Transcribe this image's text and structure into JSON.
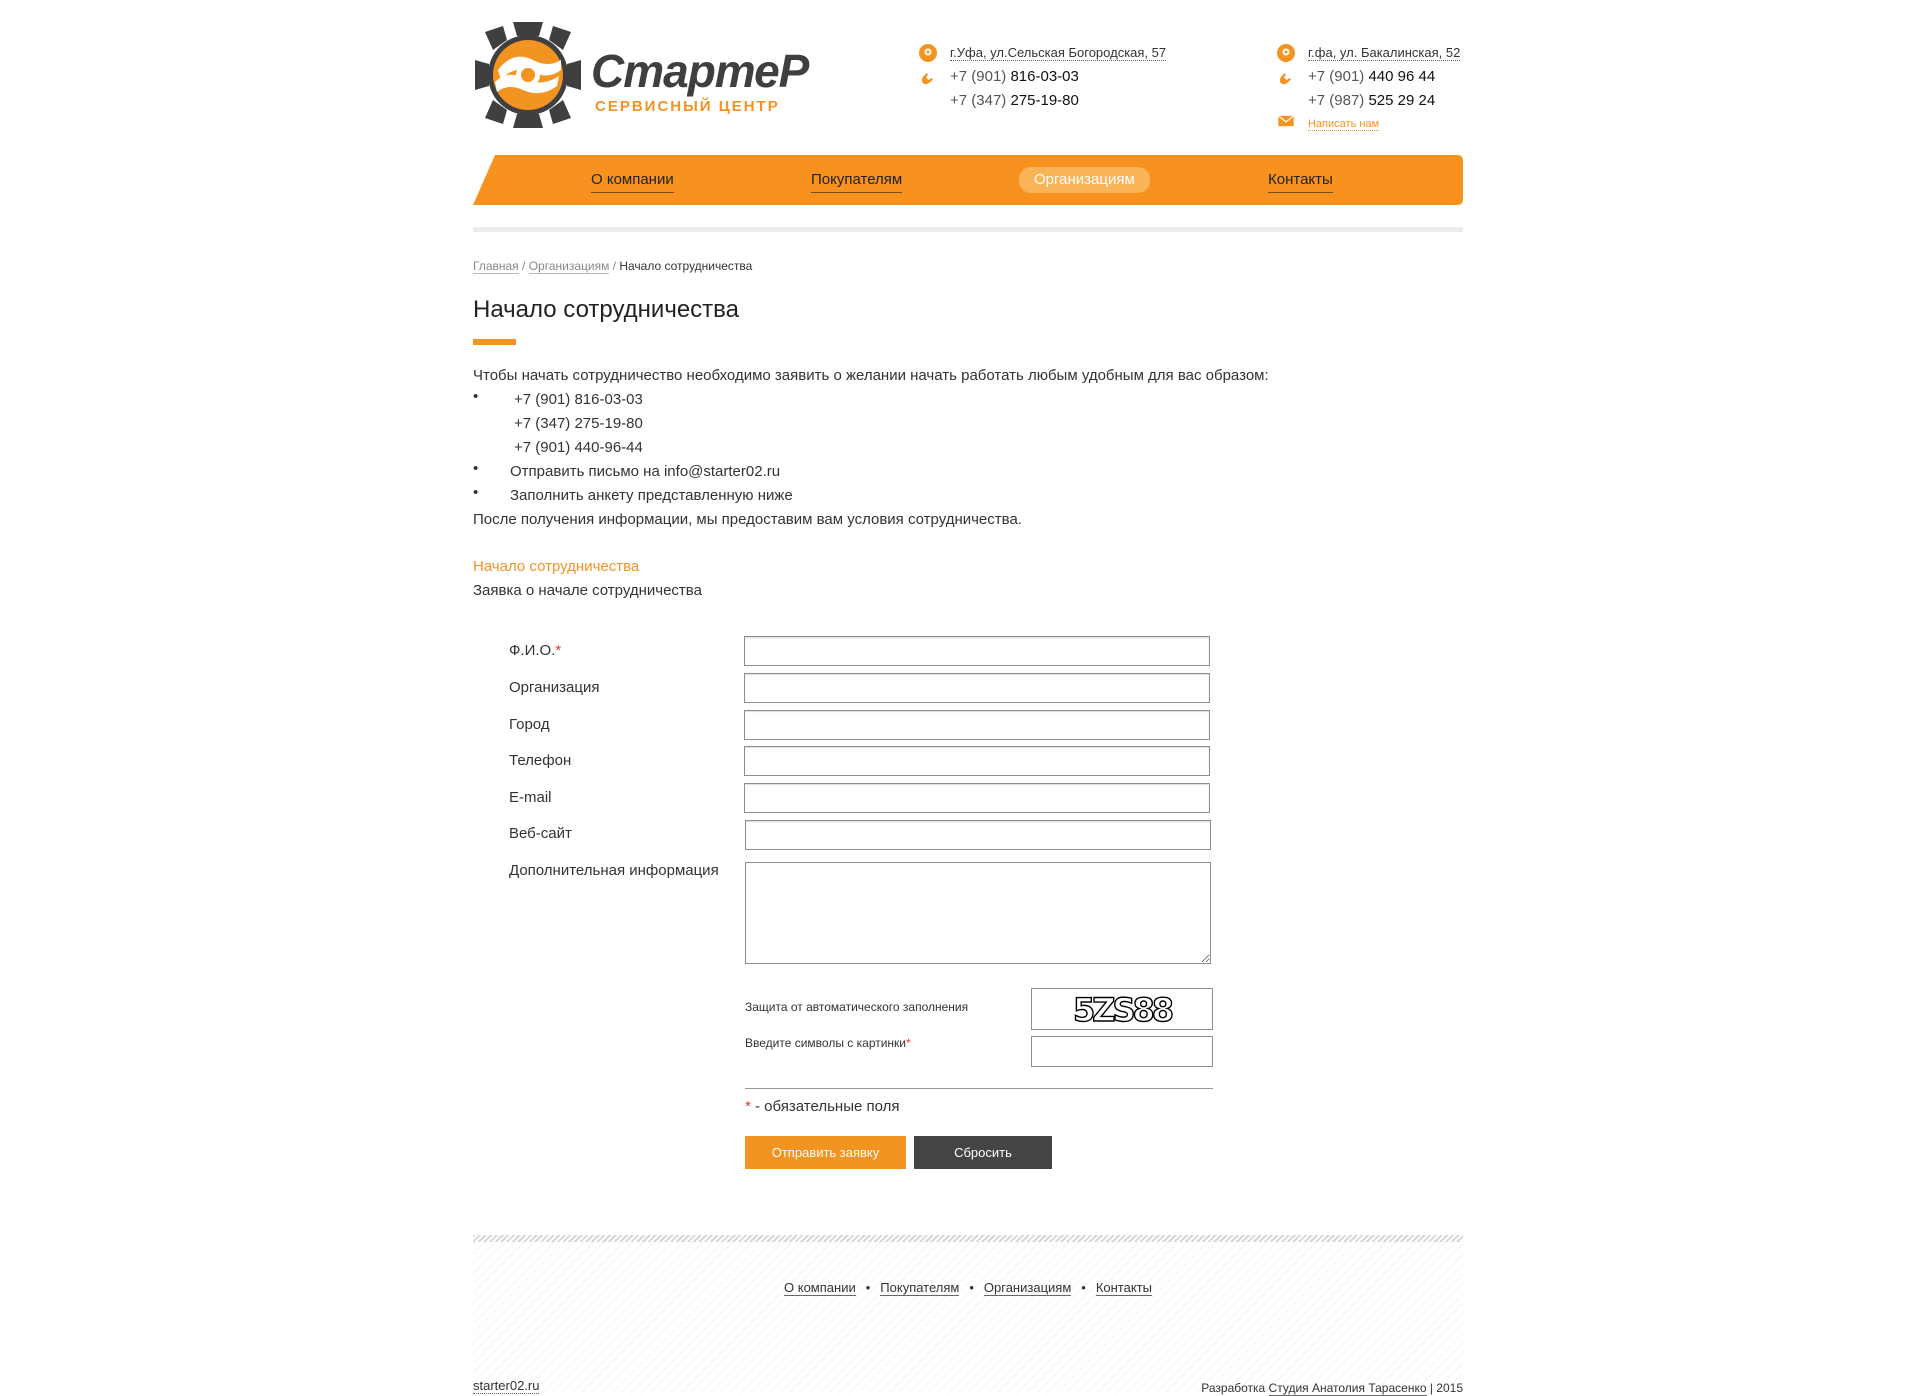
{
  "header": {
    "logo_title": "СтартеР",
    "logo_subtitle": "СЕРВИСНЫЙ ЦЕНТР",
    "contact1": {
      "address": "г.Уфа, ул.Сельская Богородская, 57",
      "phone1_code": "+7 (901)",
      "phone1_num": "816-03-03",
      "phone2_code": "+7 (347)",
      "phone2_num": "275-19-80"
    },
    "contact2": {
      "address": "г.фа, ул. Бакалинская, 52",
      "phone1_code": "+7 (901)",
      "phone1_num": "440 96 44",
      "phone2_code": "+7 (987)",
      "phone2_num": "525 29 24",
      "write_us": "Написать нам"
    }
  },
  "nav": {
    "items": [
      {
        "label": "О компании"
      },
      {
        "label": "Покупателям"
      },
      {
        "label": "Организациям"
      },
      {
        "label": "Контакты"
      }
    ],
    "active": "Организациям"
  },
  "breadcrumb": {
    "home": "Главная",
    "sep": " / ",
    "section": "Организациям",
    "current": "Начало сотрудничества"
  },
  "page": {
    "title": "Начало сотрудничества",
    "intro": "Чтобы начать сотрудничество необходимо заявить о желании начать работать любым удобным для вас образом:",
    "bullet_char": "•",
    "phones": [
      "+7 (901) 816-03-03",
      "+7 (347) 275-19-80",
      "+7 (901) 440-96-44"
    ],
    "bullet2": "Отправить письмо на info@starter02.ru",
    "bullet3": "Заполнить анкету представленную ниже",
    "outro": "После получения информации, мы предоставим вам условия сотрудничества.",
    "form_title": "Начало сотрудничества",
    "form_subtitle": "Заявка о начале сотрудничества"
  },
  "form": {
    "fields": [
      {
        "label": "Ф.И.О.",
        "required": "*"
      },
      {
        "label": "Организация"
      },
      {
        "label": "Город"
      },
      {
        "label": "Телефон"
      },
      {
        "label": "E-mail"
      },
      {
        "label": "Веб-сайт"
      },
      {
        "label": "Дополнительная информация"
      }
    ],
    "captcha_label": "Защита от автоматического заполнения",
    "captcha_text": "5ZS88",
    "captcha_input_label": "Введите символы с картинки",
    "required_mark": "*",
    "required_note": " - обязательные поля",
    "submit": "Отправить заявку",
    "reset": "Сбросить"
  },
  "footer": {
    "nav": [
      "О компании",
      "Покупателям",
      "Организациям",
      "Контакты"
    ],
    "dot": "•",
    "site": "starter02.ru",
    "dev_prefix": "Разработка ",
    "studio": "Студия Анатолия Тарасенко",
    "year": " | 2015"
  },
  "colors": {
    "accent": "#f39322",
    "dark": "#444444",
    "text": "#333333",
    "required": "#e53935"
  }
}
